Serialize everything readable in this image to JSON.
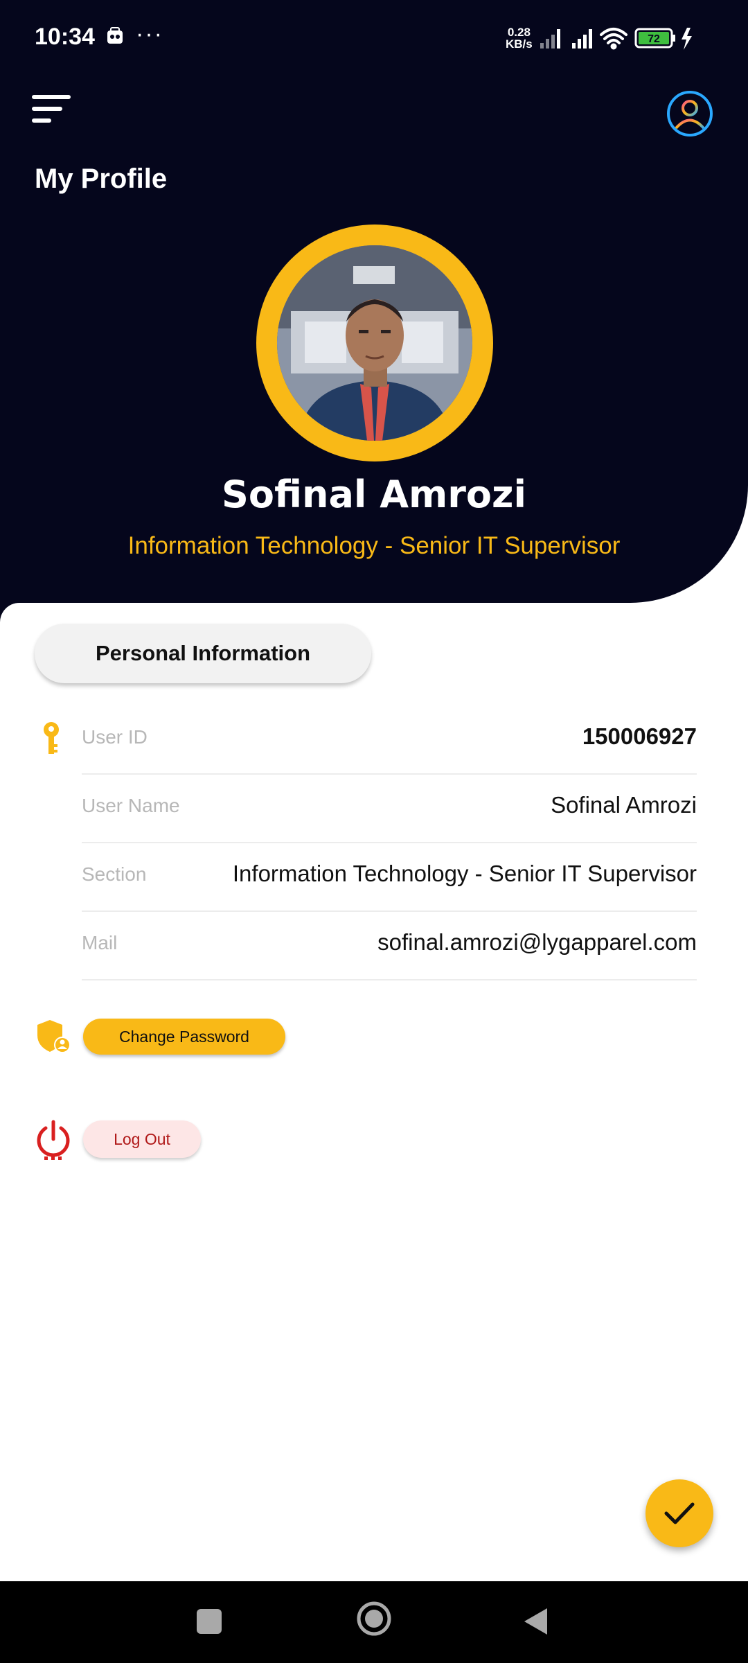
{
  "status_bar": {
    "time": "10:34",
    "more": "···",
    "speed_value": "0.28",
    "speed_unit": "KB/s",
    "battery": "72"
  },
  "header": {
    "title": "My Profile",
    "menu_icon": "menu-icon",
    "account_icon": "account-circle-icon"
  },
  "profile": {
    "name": "Sofinal Amrozi",
    "role": "Information Technology - Senior IT Supervisor"
  },
  "personal_info": {
    "tab_label": "Personal Information",
    "rows": [
      {
        "label": "User ID",
        "value": "150006927"
      },
      {
        "label": "User Name",
        "value": "Sofinal Amrozi"
      },
      {
        "label": "Section",
        "value": "Information Technology - Senior IT Supervisor"
      },
      {
        "label": "Mail",
        "value": "sofinal.amrozi@lygapparel.com"
      }
    ]
  },
  "actions": {
    "change_password_label": "Change Password",
    "logout_label": "Log Out"
  },
  "colors": {
    "header_bg": "#05061c",
    "accent": "#f9b917",
    "logout_red": "#d92020"
  }
}
